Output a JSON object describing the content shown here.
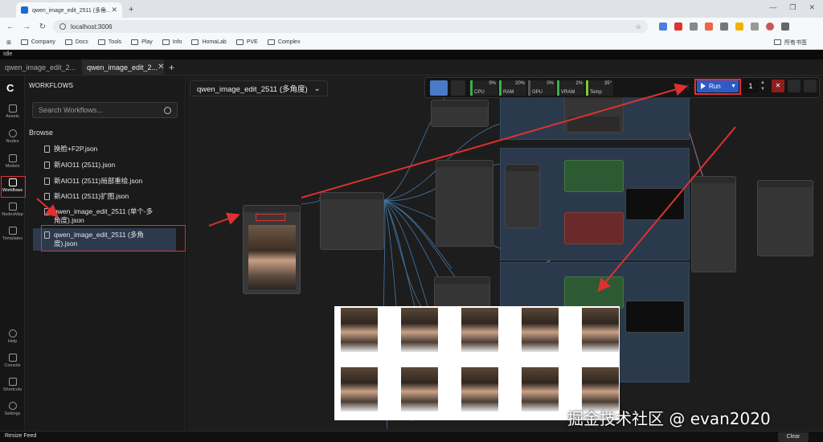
{
  "browser": {
    "tab_title": "qwen_image_edit_2511 (多角...",
    "url": "localhost:3006",
    "bookmarks": [
      "Company",
      "Docs",
      "Tools",
      "Play",
      "Info",
      "HomaLab",
      "PVE",
      "Complex"
    ],
    "bookmarks_right": "所有书签"
  },
  "app": {
    "status": "Idle",
    "tabs": [
      {
        "label": "qwen_image_edit_2..."
      },
      {
        "label": "qwen_image_edit_2..."
      }
    ],
    "iconbar": [
      {
        "label": "Assets"
      },
      {
        "label": "Nodes"
      },
      {
        "label": "Models"
      },
      {
        "label": "Workflows"
      },
      {
        "label": "NodesMap"
      },
      {
        "label": "Templates"
      },
      {
        "label": "Help"
      },
      {
        "label": "Console"
      },
      {
        "label": "Shortcuts"
      },
      {
        "label": "Settings"
      }
    ],
    "sidebar": {
      "title": "WORKFLOWS",
      "search_placeholder": "Search Workflows...",
      "browse": "Browse",
      "items": [
        "换脸+F2P.json",
        "新AIO11 (2511).json",
        "新AIO11 (2511)局部重绘.json",
        "新AIO11 (2511)扩图.json",
        "qwen_image_edit_2511 (单个-多角度).json",
        "qwen_image_edit_2511 (多角度).json"
      ]
    },
    "canvas": {
      "workflow_name": "qwen_image_edit_2511 (多角度)",
      "meters": [
        {
          "label": "CPU",
          "pct": "9%"
        },
        {
          "label": "RAM",
          "pct": "20%"
        },
        {
          "label": "GPU",
          "pct": "0%"
        },
        {
          "label": "VRAM",
          "pct": "2%"
        },
        {
          "label": "Temp",
          "pct": "35°"
        }
      ],
      "run_label": "Run",
      "batch_count": "1",
      "cancel_symbol": "✕"
    },
    "bottombar": {
      "resize": "Resize Feed",
      "clear": "Clear"
    }
  },
  "watermark": "掘金技术社区 @ evan2020",
  "colors": {
    "accent": "#2e5ac8",
    "annotation": "#e03030",
    "meter_green": "#3bb14a"
  }
}
